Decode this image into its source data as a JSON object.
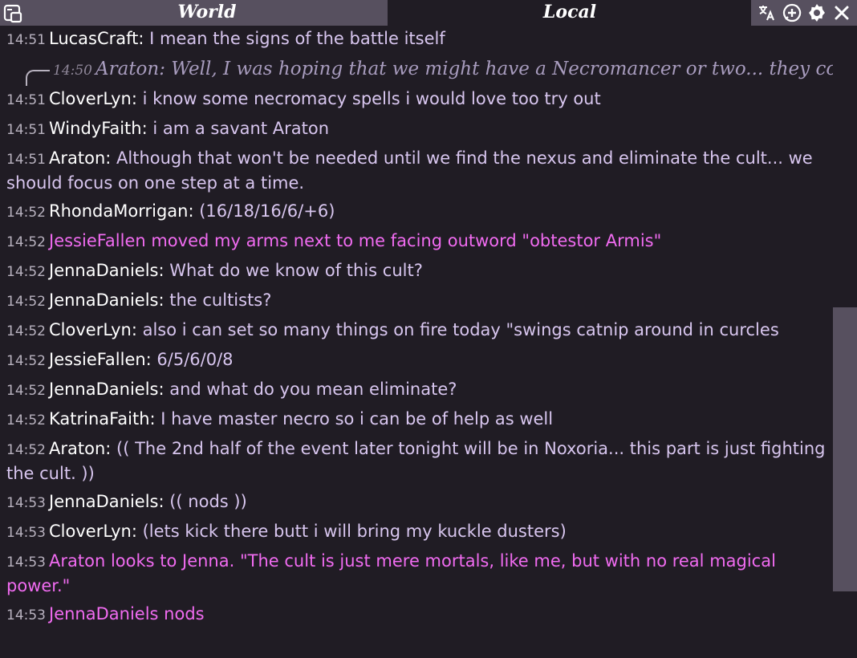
{
  "tabs": {
    "world": "World",
    "local": "Local"
  },
  "toolbar": {
    "icons": [
      "translate-icon",
      "add-chat-icon",
      "settings-icon",
      "close-icon"
    ]
  },
  "reply": {
    "time": "14:50",
    "text": "Araton: Well, I was hoping that we might have a Necromancer or two... they co..."
  },
  "messages": [
    {
      "time": "14:51",
      "name": "LucasCraft:",
      "text": " I mean the signs of the battle itself",
      "emote": false
    },
    {
      "time": "14:51",
      "name": "CloverLyn:",
      "text": " i know some necromacy spells i would love too try out",
      "emote": false
    },
    {
      "time": "14:51",
      "name": "WindyFaith:",
      "text": " i am a savant Araton",
      "emote": false
    },
    {
      "time": "14:51",
      "name": "Araton:",
      "text": " Although that won't be needed until we find the nexus and eliminate the cult... we should focus on one step at a time.",
      "emote": false
    },
    {
      "time": "14:52",
      "name": "RhondaMorrigan:",
      "text": " (16/18/16/6/+6)",
      "emote": false
    },
    {
      "time": "14:52",
      "name": "JessieFallen",
      "text": " moved my arms next to me facing outword \"obtestor Armis\"",
      "emote": true
    },
    {
      "time": "14:52",
      "name": "JennaDaniels:",
      "text": " What do we know of this cult?",
      "emote": false
    },
    {
      "time": "14:52",
      "name": "JennaDaniels:",
      "text": " the cultists?",
      "emote": false
    },
    {
      "time": "14:52",
      "name": "CloverLyn:",
      "text": " also i can set so many things on fire today \"swings catnip around in curcles",
      "emote": false
    },
    {
      "time": "14:52",
      "name": "JessieFallen:",
      "text": " 6/5/6/0/8",
      "emote": false
    },
    {
      "time": "14:52",
      "name": "JennaDaniels:",
      "text": " and what do you mean eliminate?",
      "emote": false
    },
    {
      "time": "14:52",
      "name": "KatrinaFaith:",
      "text": " I have master necro so i can be of help as well",
      "emote": false
    },
    {
      "time": "14:52",
      "name": "Araton:",
      "text": " (( The 2nd half of the event later tonight will be in Noxoria... this part is just fighting the cult. ))",
      "emote": false
    },
    {
      "time": "14:53",
      "name": "JennaDaniels:",
      "text": " (( nods ))",
      "emote": false
    },
    {
      "time": "14:53",
      "name": "CloverLyn:",
      "text": " (lets kick there butt i will bring my kuckle dusters)",
      "emote": false
    },
    {
      "time": "14:53",
      "name": "Araton",
      "text": " looks to Jenna. \"The cult is just mere mortals, like me, but with no real magical power.\"",
      "emote": true
    },
    {
      "time": "14:53",
      "name": "JennaDaniels",
      "text": " nods",
      "emote": true
    }
  ],
  "colors": {
    "background": "#201c24",
    "tab_active": "#57505f",
    "message_text": "#d8c6ef",
    "emote_text": "#f06bf0",
    "timestamp": "#b8b2bf"
  }
}
